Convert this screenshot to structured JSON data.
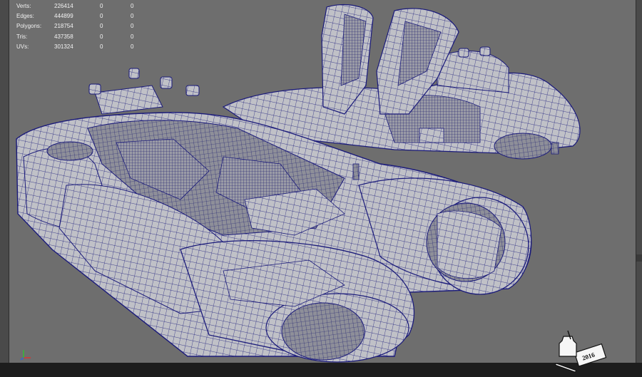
{
  "stats": [
    {
      "label": "Verts:",
      "value": "226414",
      "selected": "0",
      "extra": "0"
    },
    {
      "label": "Edges:",
      "value": "444899",
      "selected": "0",
      "extra": "0"
    },
    {
      "label": "Polygons:",
      "value": "218754",
      "selected": "0",
      "extra": "0"
    },
    {
      "label": "Tris:",
      "value": "437358",
      "selected": "0",
      "extra": "0"
    },
    {
      "label": "UVs:",
      "value": "301324",
      "selected": "0",
      "extra": "0"
    }
  ],
  "stamp": {
    "year": "2016"
  },
  "colors": {
    "viewport_bg": "#6e6e6e",
    "wireframe": "#1a1a7a",
    "surface": "#bfc0c6",
    "hud_text": "#f2f2f2"
  },
  "icons": {
    "axis": "axis-gizmo-icon",
    "stamp": "inkwell-stamp-icon"
  }
}
